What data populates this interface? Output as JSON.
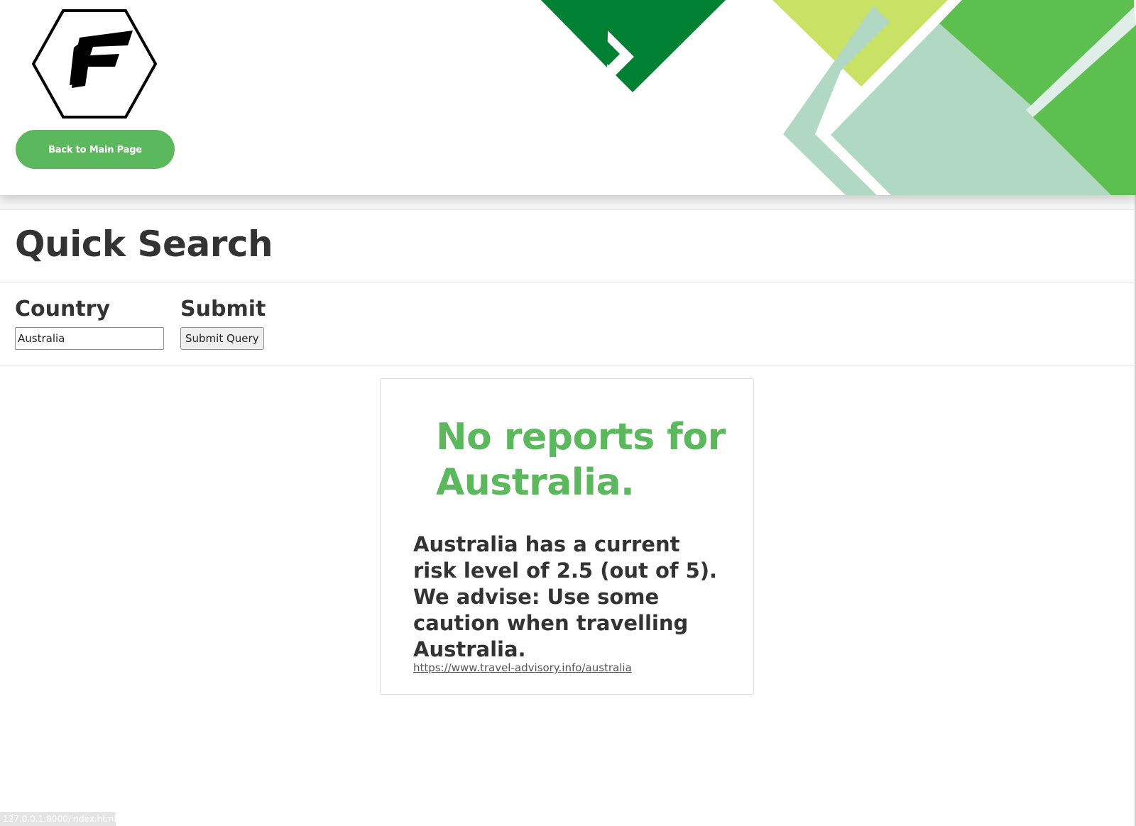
{
  "header": {
    "logo_icon": "hexagon-letter-f-logo",
    "back_button_label": "Back to Main Page",
    "accent_color": "#5cb85c",
    "decoration_colors": [
      "#008033",
      "#c9e265",
      "#5cbf4f",
      "#b1d8c3"
    ]
  },
  "search": {
    "title": "Quick Search",
    "country_label": "Country",
    "country_value": "Australia",
    "submit_label": "Submit",
    "submit_button": "Submit Query"
  },
  "result": {
    "heading": "No reports for Australia.",
    "message": "Australia has a current risk level of 2.5 (out of 5). We advise: Use some caution when travelling Australia.",
    "link_text": "https://www.travel-advisory.info/australia"
  },
  "status_bar": {
    "url": "127.0.0.1:8000/index.html"
  }
}
